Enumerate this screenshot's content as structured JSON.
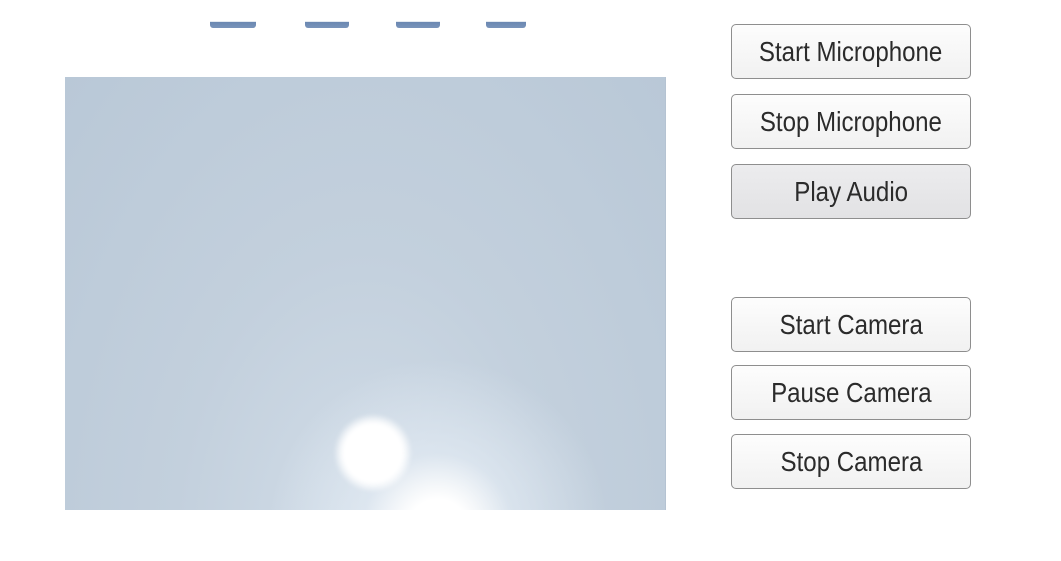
{
  "audio_controls": {
    "start_microphone_label": "Start Microphone",
    "stop_microphone_label": "Stop Microphone",
    "play_audio_label": "Play Audio"
  },
  "camera_controls": {
    "start_camera_label": "Start Camera",
    "pause_camera_label": "Pause Camera",
    "stop_camera_label": "Stop Camera"
  },
  "colors": {
    "preview_sky": "#bccad9",
    "button_border": "#8e8e8e",
    "button_text": "#2b2b2b",
    "tab_accent": "#5a7aa8"
  }
}
